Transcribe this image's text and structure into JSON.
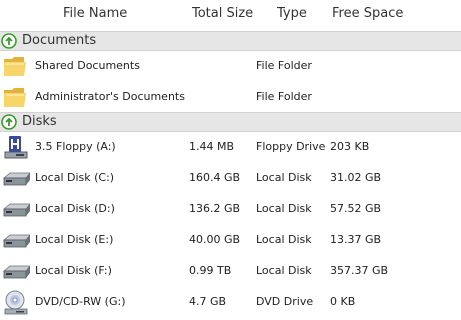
{
  "columns": {
    "name": "File Name",
    "size": "Total Size",
    "type": "Type",
    "free": "Free Space"
  },
  "groups": [
    {
      "label": "Documents",
      "items": [
        {
          "name": "Shared Documents",
          "size": "",
          "type": "File Folder",
          "free": "",
          "icon": "folder-icon"
        },
        {
          "name": "Administrator's Documents",
          "size": "",
          "type": "File Folder",
          "free": "",
          "icon": "folder-icon"
        }
      ]
    },
    {
      "label": "Disks",
      "items": [
        {
          "name": "3.5 Floppy (A:)",
          "size": "1.44 MB",
          "type": "Floppy Drive",
          "free": "203 KB",
          "icon": "floppy-drive-icon"
        },
        {
          "name": "Local Disk (C:)",
          "size": "160.4 GB",
          "type": "Local Disk",
          "free": "31.02 GB",
          "icon": "hard-disk-icon"
        },
        {
          "name": "Local Disk (D:)",
          "size": "136.2 GB",
          "type": "Local Disk",
          "free": "57.52 GB",
          "icon": "hard-disk-icon"
        },
        {
          "name": "Local Disk (E:)",
          "size": "40.00 GB",
          "type": "Local Disk",
          "free": "13.37 GB",
          "icon": "hard-disk-icon"
        },
        {
          "name": "Local Disk (F:)",
          "size": "0.99 TB",
          "type": "Local Disk",
          "free": "357.37 GB",
          "icon": "hard-disk-icon"
        },
        {
          "name": "DVD/CD-RW (G:)",
          "size": "4.7 GB",
          "type": "DVD Drive",
          "free": "0 KB",
          "icon": "dvd-drive-icon"
        }
      ]
    }
  ]
}
